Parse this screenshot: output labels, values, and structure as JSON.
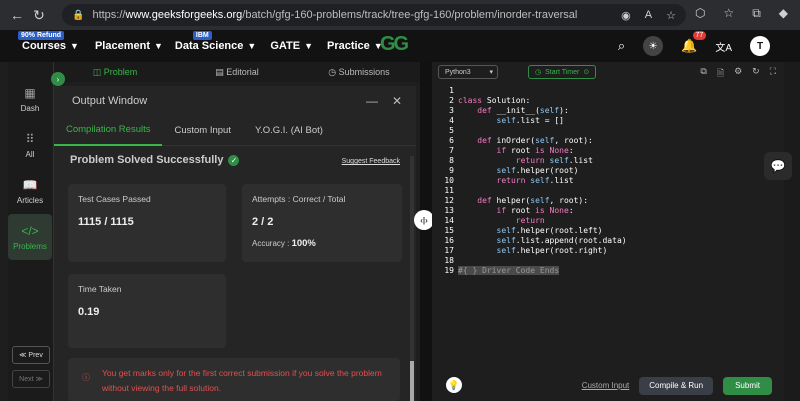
{
  "browser": {
    "url_prefix": "https://",
    "url_domain": "www.geeksforgeeks.org",
    "url_path": "/batch/gfg-160-problems/track/tree-gfg-160/problem/inorder-traversal"
  },
  "nav": {
    "items": [
      {
        "label": "Courses",
        "badge": "90% Refund"
      },
      {
        "label": "Placement",
        "badge": ""
      },
      {
        "label": "Data Science",
        "badge": "IBM"
      },
      {
        "label": "GATE",
        "badge": ""
      },
      {
        "label": "Practice",
        "badge": ""
      }
    ],
    "logo": "GG",
    "notification_count": "77",
    "avatar_letter": "T"
  },
  "sidebar": {
    "items": [
      {
        "label": "Dash"
      },
      {
        "label": "All"
      },
      {
        "label": "Articles"
      },
      {
        "label": "Problems"
      }
    ],
    "prev": "≪ Prev",
    "next": "Next ≫"
  },
  "tabs": [
    "Problem",
    "Editorial",
    "Submissions"
  ],
  "output": {
    "title": "Output Window",
    "subtabs": [
      "Compilation Results",
      "Custom Input",
      "Y.O.G.I. (AI Bot)"
    ],
    "status": "Problem Solved Successfully",
    "feedback": "Suggest Feedback",
    "test_cases_label": "Test Cases Passed",
    "test_cases_value": "1115 / 1115",
    "attempts_label": "Attempts : Correct / Total",
    "attempts_value": "2 / 2",
    "accuracy_label": "Accuracy :",
    "accuracy_value": "100%",
    "time_label": "Time Taken",
    "time_value": "0.19",
    "warning": "You get marks only for the first correct submission if you solve the problem without viewing the full solution."
  },
  "editor": {
    "language": "Python3",
    "timer": "Start Timer",
    "custom_input": "Custom Input",
    "run": "Compile & Run",
    "submit": "Submit",
    "line_numbers": [
      "1",
      "2",
      "3",
      "4",
      "5",
      "6",
      "7",
      "8",
      "9",
      "10",
      "11",
      "12",
      "13",
      "14",
      "15",
      "16",
      "17",
      "18",
      "19"
    ]
  }
}
